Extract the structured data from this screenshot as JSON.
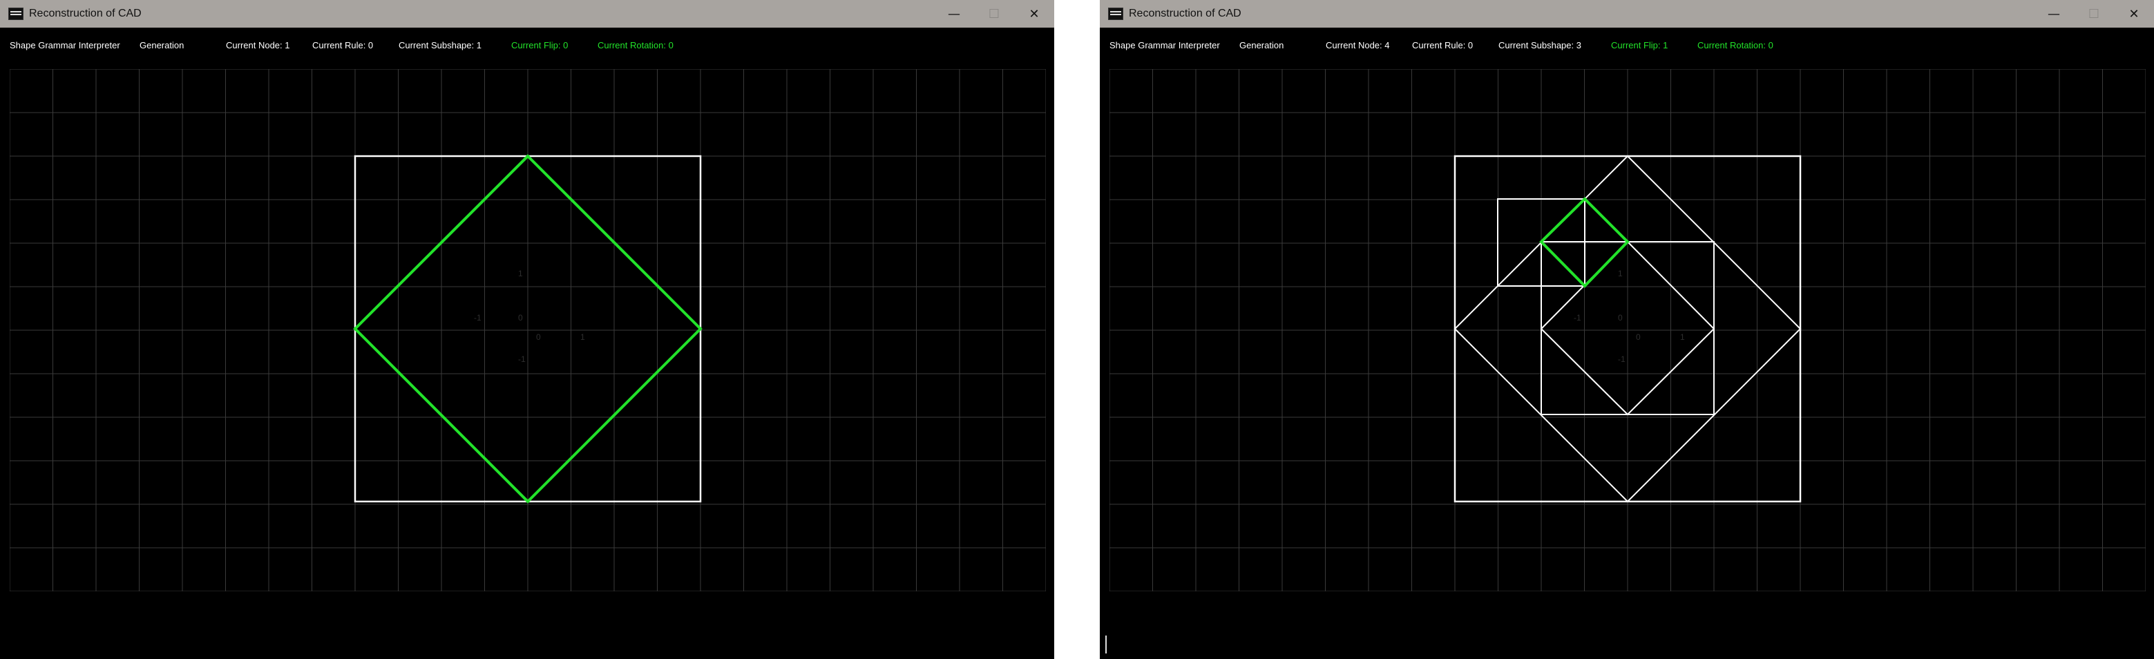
{
  "left": {
    "title": "Reconstruction of CAD",
    "toolbar": {
      "app_name": "Shape Grammar Interpreter",
      "generation": "Generation",
      "node": "Current Node: 1",
      "rule": "Current Rule: 0",
      "subshape": "Current Subshape: 1",
      "flip": "Current Flip: 0",
      "rotation": "Current Rotation: 0"
    },
    "axis_labels": [
      "1",
      "-1",
      "0",
      "0",
      "1",
      "-1"
    ]
  },
  "right": {
    "title": "Reconstruction of CAD",
    "toolbar": {
      "app_name": "Shape Grammar Interpreter",
      "generation": "Generation",
      "node": "Current Node: 4",
      "rule": "Current Rule: 0",
      "subshape": "Current Subshape: 3",
      "flip": "Current Flip: 1",
      "rotation": "Current Rotation: 0"
    },
    "axis_labels": [
      "1",
      "-1",
      "0",
      "0",
      "1",
      "-1"
    ]
  },
  "window_controls": {
    "minimize": "—",
    "maximize": "☐",
    "close": "✕"
  },
  "colors": {
    "background": "#000000",
    "grid": "#3a3a3a",
    "shape": "#ffffff",
    "highlight": "#22e22a",
    "titlebar": "#a8a4a0"
  }
}
